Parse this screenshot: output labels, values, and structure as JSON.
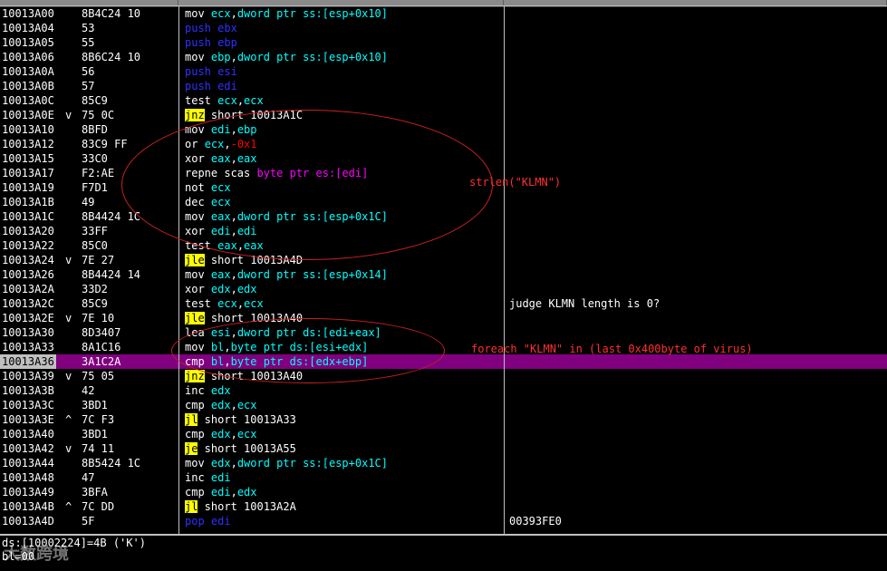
{
  "rows": [
    {
      "addr": "10013A00",
      "mark": "",
      "hex": "8B4C24 10",
      "instr": [
        [
          "m",
          "mov "
        ],
        [
          "r",
          "ecx"
        ],
        [
          "m",
          ","
        ],
        [
          "r",
          "dword ptr ss:[esp+0x10]"
        ]
      ],
      "comment": ""
    },
    {
      "addr": "10013A04",
      "mark": "",
      "hex": "53",
      "instr": [
        [
          "push",
          "push "
        ],
        [
          "push",
          "ebx"
        ]
      ],
      "comment": ""
    },
    {
      "addr": "10013A05",
      "mark": "",
      "hex": "55",
      "instr": [
        [
          "push",
          "push "
        ],
        [
          "push",
          "ebp"
        ]
      ],
      "comment": ""
    },
    {
      "addr": "10013A06",
      "mark": "",
      "hex": "8B6C24 10",
      "instr": [
        [
          "m",
          "mov "
        ],
        [
          "r",
          "ebp"
        ],
        [
          "m",
          ","
        ],
        [
          "r",
          "dword ptr ss:[esp+0x10]"
        ]
      ],
      "comment": ""
    },
    {
      "addr": "10013A0A",
      "mark": "",
      "hex": "56",
      "instr": [
        [
          "push",
          "push "
        ],
        [
          "push",
          "esi"
        ]
      ],
      "comment": ""
    },
    {
      "addr": "10013A0B",
      "mark": "",
      "hex": "57",
      "instr": [
        [
          "push",
          "push "
        ],
        [
          "push",
          "edi"
        ]
      ],
      "comment": ""
    },
    {
      "addr": "10013A0C",
      "mark": "",
      "hex": "85C9",
      "instr": [
        [
          "m",
          "test "
        ],
        [
          "r",
          "ecx"
        ],
        [
          "m",
          ","
        ],
        [
          "r",
          "ecx"
        ]
      ],
      "comment": ""
    },
    {
      "addr": "10013A0E",
      "mark": "v",
      "hex": "75 0C",
      "instr": [
        [
          "jmp",
          "jnz"
        ],
        [
          "m",
          " short 10013A1C"
        ]
      ],
      "comment": ""
    },
    {
      "addr": "10013A10",
      "mark": "",
      "hex": "8BFD",
      "instr": [
        [
          "m",
          "mov "
        ],
        [
          "r",
          "edi"
        ],
        [
          "m",
          ","
        ],
        [
          "r",
          "ebp"
        ]
      ],
      "comment": ""
    },
    {
      "addr": "10013A12",
      "mark": "",
      "hex": "83C9 FF",
      "instr": [
        [
          "m",
          "or "
        ],
        [
          "r",
          "ecx"
        ],
        [
          "m",
          ","
        ],
        [
          "num",
          "-0x1"
        ]
      ],
      "comment": ""
    },
    {
      "addr": "10013A15",
      "mark": "",
      "hex": "33C0",
      "instr": [
        [
          "m",
          "xor "
        ],
        [
          "r",
          "eax"
        ],
        [
          "m",
          ","
        ],
        [
          "r",
          "eax"
        ]
      ],
      "comment": ""
    },
    {
      "addr": "10013A17",
      "mark": "",
      "hex": "F2:AE",
      "instr": [
        [
          "m",
          "repne scas "
        ],
        [
          "kw",
          "byte ptr es:[edi]"
        ]
      ],
      "comment": ""
    },
    {
      "addr": "10013A19",
      "mark": "",
      "hex": "F7D1",
      "instr": [
        [
          "m",
          "not "
        ],
        [
          "r",
          "ecx"
        ]
      ],
      "comment": ""
    },
    {
      "addr": "10013A1B",
      "mark": "",
      "hex": "49",
      "instr": [
        [
          "m",
          "dec "
        ],
        [
          "r",
          "ecx"
        ]
      ],
      "comment": ""
    },
    {
      "addr": "10013A1C",
      "mark": "",
      "hex": "8B4424 1C",
      "instr": [
        [
          "m",
          "mov "
        ],
        [
          "r",
          "eax"
        ],
        [
          "m",
          ","
        ],
        [
          "r",
          "dword ptr ss:[esp+0x1C]"
        ]
      ],
      "comment": ""
    },
    {
      "addr": "10013A20",
      "mark": "",
      "hex": "33FF",
      "instr": [
        [
          "m",
          "xor "
        ],
        [
          "r",
          "edi"
        ],
        [
          "m",
          ","
        ],
        [
          "r",
          "edi"
        ]
      ],
      "comment": ""
    },
    {
      "addr": "10013A22",
      "mark": "",
      "hex": "85C0",
      "instr": [
        [
          "m",
          "test "
        ],
        [
          "r",
          "eax"
        ],
        [
          "m",
          ","
        ],
        [
          "r",
          "eax"
        ]
      ],
      "comment": ""
    },
    {
      "addr": "10013A24",
      "mark": "v",
      "hex": "7E 27",
      "instr": [
        [
          "jmp",
          "jle"
        ],
        [
          "m",
          " short 10013A4D"
        ]
      ],
      "comment": ""
    },
    {
      "addr": "10013A26",
      "mark": "",
      "hex": "8B4424 14",
      "instr": [
        [
          "m",
          "mov "
        ],
        [
          "r",
          "eax"
        ],
        [
          "m",
          ","
        ],
        [
          "r",
          "dword ptr ss:[esp+0x14]"
        ]
      ],
      "comment": ""
    },
    {
      "addr": "10013A2A",
      "mark": "",
      "hex": "33D2",
      "instr": [
        [
          "m",
          "xor "
        ],
        [
          "r",
          "edx"
        ],
        [
          "m",
          ","
        ],
        [
          "r",
          "edx"
        ]
      ],
      "comment": ""
    },
    {
      "addr": "10013A2C",
      "mark": "",
      "hex": "85C9",
      "instr": [
        [
          "m",
          "test "
        ],
        [
          "r",
          "ecx"
        ],
        [
          "m",
          ","
        ],
        [
          "r",
          "ecx"
        ]
      ],
      "comment": "judge KLMN length is 0?"
    },
    {
      "addr": "10013A2E",
      "mark": "v",
      "hex": "7E 10",
      "instr": [
        [
          "jmp",
          "jle"
        ],
        [
          "m",
          " short 10013A40"
        ]
      ],
      "comment": ""
    },
    {
      "addr": "10013A30",
      "mark": "",
      "hex": "8D3407",
      "instr": [
        [
          "m",
          "lea "
        ],
        [
          "r",
          "esi"
        ],
        [
          "m",
          ","
        ],
        [
          "r",
          "dword ptr ds:[edi+eax]"
        ]
      ],
      "comment": ""
    },
    {
      "addr": "10013A33",
      "mark": "",
      "hex": "8A1C16",
      "instr": [
        [
          "m",
          "mov "
        ],
        [
          "r",
          "bl"
        ],
        [
          "m",
          ","
        ],
        [
          "r",
          "byte ptr ds:[esi+edx]"
        ]
      ],
      "comment": ""
    },
    {
      "addr": "10013A36",
      "mark": "",
      "hex": "3A1C2A",
      "instr": [
        [
          "m",
          "cmp "
        ],
        [
          "r",
          "bl"
        ],
        [
          "m",
          ","
        ],
        [
          "r",
          "byte ptr ds:[edx+ebp]"
        ]
      ],
      "comment": "",
      "selected": true
    },
    {
      "addr": "10013A39",
      "mark": "v",
      "hex": "75 05",
      "instr": [
        [
          "jmp",
          "jnz"
        ],
        [
          "m",
          " short 10013A40"
        ]
      ],
      "comment": ""
    },
    {
      "addr": "10013A3B",
      "mark": "",
      "hex": "42",
      "instr": [
        [
          "m",
          "inc "
        ],
        [
          "r",
          "edx"
        ]
      ],
      "comment": ""
    },
    {
      "addr": "10013A3C",
      "mark": "",
      "hex": "3BD1",
      "instr": [
        [
          "m",
          "cmp "
        ],
        [
          "r",
          "edx"
        ],
        [
          "m",
          ","
        ],
        [
          "r",
          "ecx"
        ]
      ],
      "comment": ""
    },
    {
      "addr": "10013A3E",
      "mark": "^",
      "hex": "7C F3",
      "instr": [
        [
          "jmp",
          "jl"
        ],
        [
          "m",
          " short 10013A33"
        ]
      ],
      "comment": ""
    },
    {
      "addr": "10013A40",
      "mark": "",
      "hex": "3BD1",
      "instr": [
        [
          "m",
          "cmp "
        ],
        [
          "r",
          "edx"
        ],
        [
          "m",
          ","
        ],
        [
          "r",
          "ecx"
        ]
      ],
      "comment": ""
    },
    {
      "addr": "10013A42",
      "mark": "v",
      "hex": "74 11",
      "instr": [
        [
          "jmp",
          "je"
        ],
        [
          "m",
          " short 10013A55"
        ]
      ],
      "comment": ""
    },
    {
      "addr": "10013A44",
      "mark": "",
      "hex": "8B5424 1C",
      "instr": [
        [
          "m",
          "mov "
        ],
        [
          "r",
          "edx"
        ],
        [
          "m",
          ","
        ],
        [
          "r",
          "dword ptr ss:[esp+0x1C]"
        ]
      ],
      "comment": ""
    },
    {
      "addr": "10013A48",
      "mark": "",
      "hex": "47",
      "instr": [
        [
          "m",
          "inc "
        ],
        [
          "r",
          "edi"
        ]
      ],
      "comment": ""
    },
    {
      "addr": "10013A49",
      "mark": "",
      "hex": "3BFA",
      "instr": [
        [
          "m",
          "cmp "
        ],
        [
          "r",
          "edi"
        ],
        [
          "m",
          ","
        ],
        [
          "r",
          "edx"
        ]
      ],
      "comment": ""
    },
    {
      "addr": "10013A4B",
      "mark": "^",
      "hex": "7C DD",
      "instr": [
        [
          "jmp",
          "jl"
        ],
        [
          "m",
          " short 10013A2A"
        ]
      ],
      "comment": ""
    },
    {
      "addr": "10013A4D",
      "mark": "",
      "hex": "5F",
      "instr": [
        [
          "push",
          "pop "
        ],
        [
          "push",
          "edi"
        ]
      ],
      "comment": "00393FE0"
    }
  ],
  "annotations": {
    "strlen": "strlen(\"KLMN\")",
    "foreach": "foreach \"KLMN\" in (last 0x400byte of virus)"
  },
  "status": {
    "line1": "ds:[10002224]=4B ('K')",
    "line2": "bl=00"
  },
  "watermark": "大数跨境",
  "colors": {
    "selected_row": "#800080",
    "register": "#00ffff",
    "jump_highlight": "#ffff00",
    "annotation": "#ff3030"
  }
}
